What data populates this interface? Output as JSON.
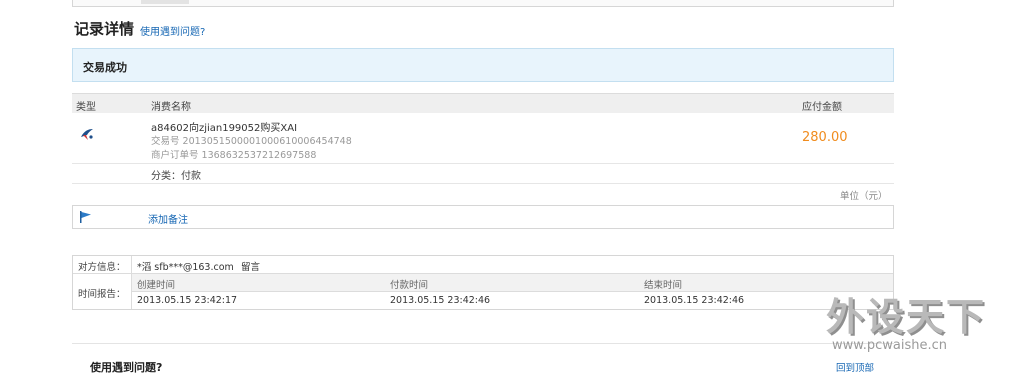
{
  "section": {
    "title": "记录详情",
    "help_link": "使用遇到问题?"
  },
  "status": {
    "text": "交易成功"
  },
  "table": {
    "headers": {
      "type": "类型",
      "name": "消费名称",
      "amount": "应付金额"
    },
    "row": {
      "title": "a84602向zjian199052购买XAI",
      "trade_no": "交易号  2013051500001000610006454748",
      "merchant_order": "商户订单号  1368632537212697588",
      "amount": "280.00",
      "category": "分类：付款"
    }
  },
  "unit": "单位（元）",
  "remark": {
    "add_label": "添加备注"
  },
  "info": {
    "party_label": "对方信息：",
    "party_value": "*滔  sfb***@163.com",
    "message_link": "留言",
    "time_label": "时间报告：",
    "columns": [
      "创建时间",
      "付款时间",
      "结束时间"
    ],
    "values": [
      "2013.05.15 23:42:17",
      "2013.05.15 23:42:46",
      "2013.05.15 23:42:46"
    ]
  },
  "footer": {
    "faq_title": "使用遇到问题?",
    "back_to_top": "回到顶部"
  },
  "watermark": {
    "brand": "外设天下",
    "url": "www.pcwaishe.cn"
  },
  "colors": {
    "link": "#1566b3",
    "amount": "#f08c1e",
    "status_bg": "#e8f4fc"
  },
  "icons": {
    "type": "transfer-bird-icon",
    "remark": "flag-icon"
  }
}
